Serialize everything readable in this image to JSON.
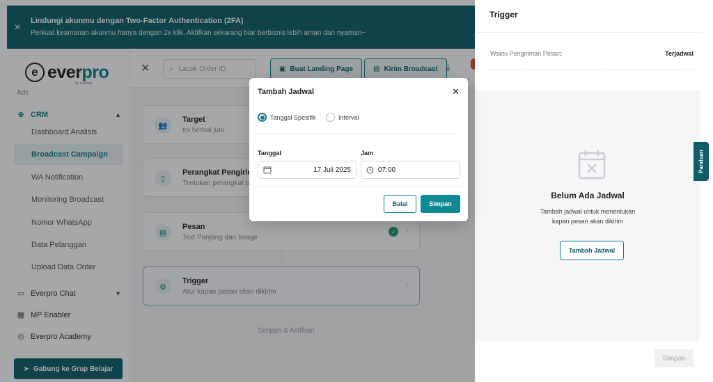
{
  "banner": {
    "title": "Lindungi akunmu dengan Two-Factor Authentication (2FA)",
    "subtitle": "Perkuat keamanan akunmu hanya dengan 2x klik. Aktifkan sekarang biar berbisnis lebih aman dan nyaman~"
  },
  "logo": {
    "mark": "e",
    "text_left": "ever",
    "text_right": "pro",
    "byline": "by everhop"
  },
  "sidebar": {
    "partial_item": "Ads",
    "groups": [
      {
        "label": "CRM",
        "icon": "crm-icon"
      },
      {
        "label": "Everpro Chat",
        "icon": "chat-icon"
      },
      {
        "label": "MP Enabler",
        "icon": "store-icon"
      },
      {
        "label": "Everpro Academy",
        "icon": "academy-icon"
      }
    ],
    "crm_items": [
      {
        "label": "Dashboard Analisis"
      },
      {
        "label": "Broadcast Campaign"
      },
      {
        "label": "WA Notification"
      },
      {
        "label": "Monitoring Broadcast"
      },
      {
        "label": "Nomor WhatsApp"
      },
      {
        "label": "Data Pelanggan"
      },
      {
        "label": "Upload Data Order"
      }
    ],
    "join_button": "Gabung ke Grup Belajar"
  },
  "topbar": {
    "search_placeholder": "Lacak Order ID",
    "landing_button": "Buat Landing Page",
    "broadcast_button": "Kirim Broadcast"
  },
  "steps": [
    {
      "title": "Target",
      "desc": "trx herbal juni"
    },
    {
      "title": "Perangkat Pengirim",
      "desc": "Tentukan perangkat pengirim"
    },
    {
      "title": "Pesan",
      "desc": "Text Panjang dan Image"
    },
    {
      "title": "Trigger",
      "desc": "Atur kapan pesan akan dikirim"
    }
  ],
  "content": {
    "save_activate": "Simpan & Aktifkan"
  },
  "panel": {
    "title": "Trigger",
    "send_time_label": "Waktu Pengiriman Pesan:",
    "send_time_value": "Terjadwal",
    "empty_title": "Belum Ada Jadwal",
    "empty_desc": "Tambah jadwal untuk menentukan kapan pesan akan dikirim",
    "add_button": "Tambah Jadwal",
    "save_button": "Simpan",
    "guide_tab": "Panduan"
  },
  "modal": {
    "title": "Tambah Jadwal",
    "option_specific": "Tanggal Spesifik",
    "option_interval": "Interval",
    "date_label": "Tanggal",
    "date_value": "17 Juli 2025",
    "time_label": "Jam",
    "time_value": "07:00",
    "cancel_button": "Batal",
    "save_button": "Simpan"
  },
  "colors": {
    "primary": "#0e5d67",
    "accent": "#0e8a94",
    "success": "#1b9a75"
  }
}
